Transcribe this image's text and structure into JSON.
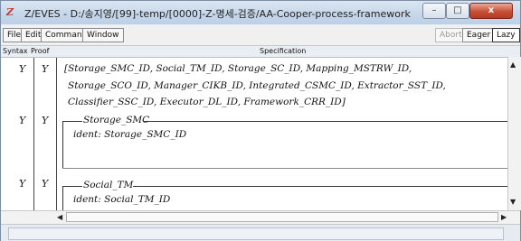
{
  "window": {
    "icon_text": "Z",
    "title": "Z/EVES - D:/송지영/[99]-temp/[0000]-Z-명세-검증/AA-Cooper-process-framework",
    "controls": {
      "minimize": "–",
      "maximize": "□",
      "close": "x"
    }
  },
  "menu": {
    "file": "File",
    "edit": "Edit",
    "command": "Command",
    "window": "Window",
    "abort": "Abort",
    "eager": "Eager",
    "lazy": "Lazy"
  },
  "columns": {
    "syntax": "Syntax",
    "proof": "Proof",
    "specification": "Specification"
  },
  "rows": [
    {
      "syntax": "Y",
      "proof": "Y",
      "lines": [
        "[Storage_SMC_ID, Social_TM_ID, Storage_SC_ID, Mapping_MSTRW_ID,",
        "Storage_SCO_ID, Manager_CIKB_ID, Integrated_CSMC_ID, Extractor_SST_ID,",
        "Classifier_SSC_ID, Executor_DL_ID, Framework_CRR_ID]"
      ]
    },
    {
      "syntax": "Y",
      "proof": "Y",
      "schema_name": "Storage_SMC",
      "declaration": "ident: Storage_SMC_ID"
    },
    {
      "syntax": "Y",
      "proof": "Y",
      "schema_name": "Social_TM",
      "declaration": "ident: Social_TM_ID"
    }
  ],
  "scrollbar": {
    "up": "▲",
    "down": "▼",
    "left": "◀",
    "right": "▶"
  }
}
